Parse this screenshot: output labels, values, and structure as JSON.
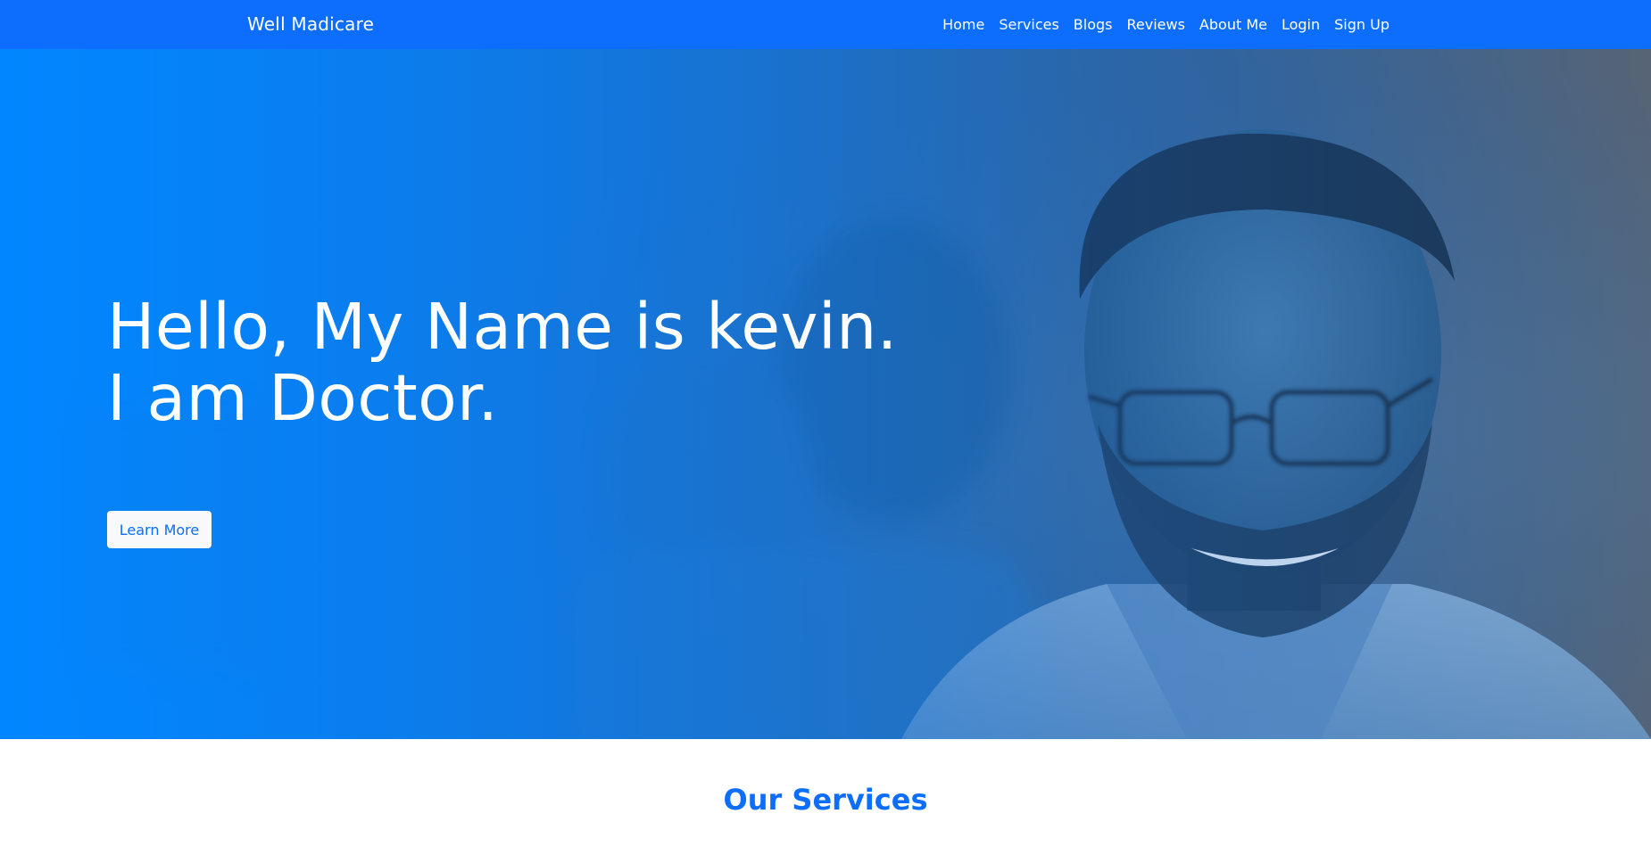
{
  "navbar": {
    "brand": "Well Madicare",
    "links": [
      "Home",
      "Services",
      "Blogs",
      "Reviews",
      "About Me",
      "Login",
      "Sign Up"
    ]
  },
  "hero": {
    "heading_line1": "Hello, My Name is kevin.",
    "heading_line2": "I am Doctor.",
    "button_label": "Learn More"
  },
  "services": {
    "title": "Our Services"
  },
  "colors": {
    "primary": "#0d6efd",
    "hero_gradient_start": "#0286ff",
    "button_bg": "#f8f9fa"
  }
}
